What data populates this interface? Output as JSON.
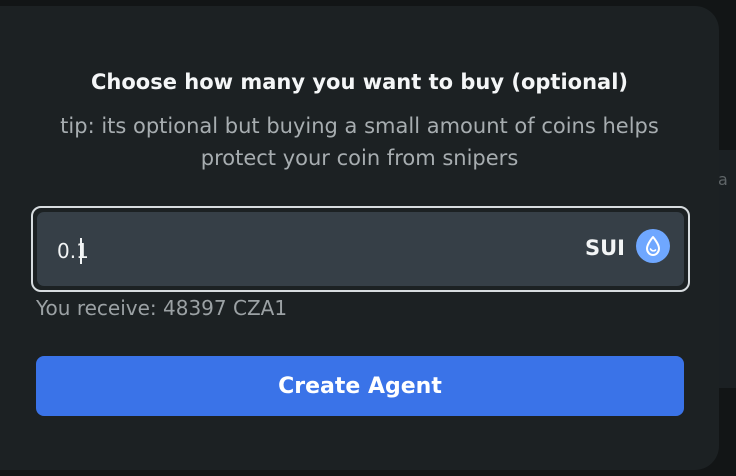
{
  "background": {
    "fragment_text": "a"
  },
  "modal": {
    "title": "Choose how many you want to buy (optional)",
    "tip": "tip: its optional but buying a small amount of coins helps protect your coin from snipers",
    "amount_input": {
      "value": "0.1",
      "currency": "SUI",
      "currency_icon": "sui-droplet-icon"
    },
    "receive_text": "You receive: 48397 CZA1",
    "create_button_label": "Create Agent"
  },
  "colors": {
    "accent": "#3a73e8",
    "sui_icon": "#6fa7ff",
    "modal_bg": "#1c2123",
    "input_bg": "#363f47"
  }
}
